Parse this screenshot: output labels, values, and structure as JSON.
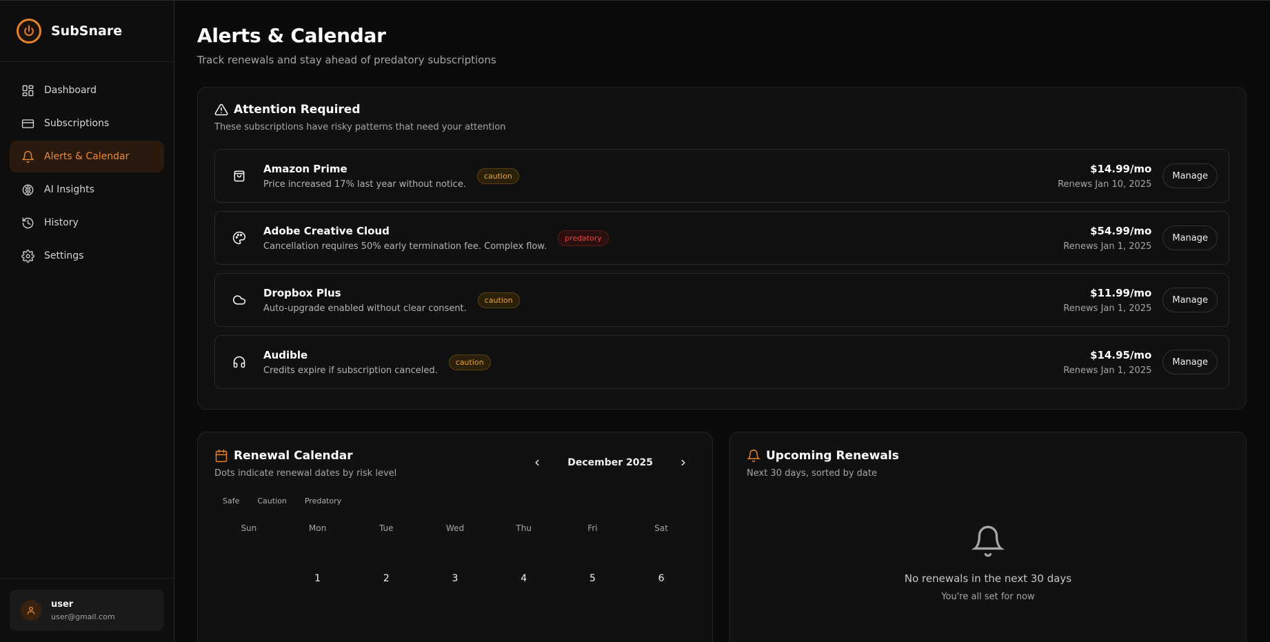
{
  "brand": {
    "name": "SubSnare",
    "accent": "#e8822a"
  },
  "sidebar": {
    "items": [
      {
        "label": "Dashboard",
        "icon": "grid-icon"
      },
      {
        "label": "Subscriptions",
        "icon": "credit-card-icon"
      },
      {
        "label": "Alerts & Calendar",
        "icon": "bell-icon",
        "active": true
      },
      {
        "label": "AI Insights",
        "icon": "brain-icon"
      },
      {
        "label": "History",
        "icon": "history-icon"
      },
      {
        "label": "Settings",
        "icon": "gear-icon"
      }
    ]
  },
  "user": {
    "name": "user",
    "email": "user@gmail.com"
  },
  "header": {
    "title": "Alerts & Calendar",
    "subtitle": "Track renewals and stay ahead of predatory subscriptions"
  },
  "attention": {
    "title": "Attention Required",
    "description": "These subscriptions have risky patterns that need your attention",
    "items": [
      {
        "name": "Amazon Prime",
        "reason": "Price increased 17% last year without notice.",
        "badge": "caution",
        "price": "$14.99/mo",
        "renews": "Renews Jan 10, 2025",
        "action": "Manage",
        "icon": "shopping-bag-icon"
      },
      {
        "name": "Adobe Creative Cloud",
        "reason": "Cancellation requires 50% early termination fee. Complex flow.",
        "badge": "predatory",
        "price": "$54.99/mo",
        "renews": "Renews Jan 1, 2025",
        "action": "Manage",
        "icon": "palette-icon"
      },
      {
        "name": "Dropbox Plus",
        "reason": "Auto-upgrade enabled without clear consent.",
        "badge": "caution",
        "price": "$11.99/mo",
        "renews": "Renews Jan 1, 2025",
        "action": "Manage",
        "icon": "cloud-icon"
      },
      {
        "name": "Audible",
        "reason": "Credits expire if subscription canceled.",
        "badge": "caution",
        "price": "$14.95/mo",
        "renews": "Renews Jan 1, 2025",
        "action": "Manage",
        "icon": "headphones-icon"
      }
    ]
  },
  "calendar": {
    "title": "Renewal Calendar",
    "description": "Dots indicate renewal dates by risk level",
    "month": "December 2025",
    "legend": [
      "Safe",
      "Caution",
      "Predatory"
    ],
    "weekdays": [
      "Sun",
      "Mon",
      "Tue",
      "Wed",
      "Thu",
      "Fri",
      "Sat"
    ],
    "first_week": [
      "",
      "1",
      "2",
      "3",
      "4",
      "5",
      "6"
    ]
  },
  "upcoming": {
    "title": "Upcoming Renewals",
    "description": "Next 30 days, sorted by date",
    "empty_title": "No renewals in the next 30 days",
    "empty_subtitle": "You're all set for now"
  }
}
